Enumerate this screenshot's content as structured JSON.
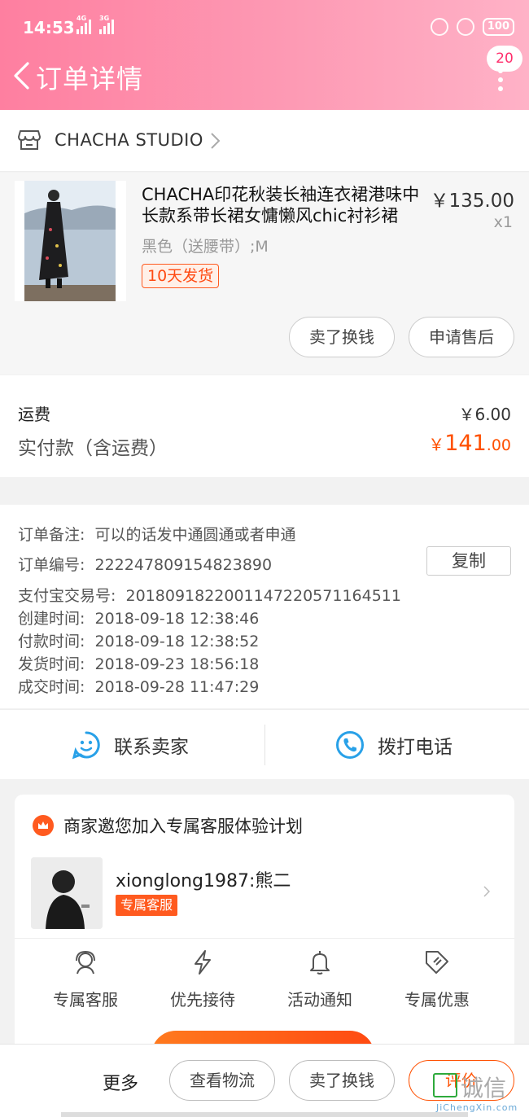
{
  "status_bar": {
    "time": "14:53",
    "sig1_tag": "4G",
    "sig2_tag": "3G",
    "battery": "100"
  },
  "nav": {
    "title": "订单详情",
    "message_count": "20"
  },
  "shop": {
    "name": "CHACHA STUDIO"
  },
  "product": {
    "title": "CHACHA印花秋装长袖连衣裙港味中长款系带长裙女慵懒风chic衬衫裙",
    "price": "￥135.00",
    "qty": "x1",
    "spec": "黑色（送腰带）;M",
    "ship_tag": "10天发货",
    "btn_sell": "卖了换钱",
    "btn_after_sale": "申请售后"
  },
  "payment": {
    "freight_label": "运费",
    "freight_value": "￥6.00",
    "paid_label": "实付款（含运费）",
    "paid_currency": "￥",
    "paid_int": "141",
    "paid_dec": ".00"
  },
  "info": {
    "remark_label": "订单备注:",
    "remark_value": "可以的话发中通圆通或者申通",
    "order_no_label": "订单编号:",
    "order_no_value": "222247809154823890",
    "copy_btn": "复制",
    "alipay_label": "支付宝交易号:",
    "alipay_value": "2018091822001147220571164511",
    "created_label": "创建时间:",
    "created_value": "2018-09-18 12:38:46",
    "paid_time_label": "付款时间:",
    "paid_time_value": "2018-09-18 12:38:52",
    "shipped_label": "发货时间:",
    "shipped_value": "2018-09-23 18:56:18",
    "done_label": "成交时间:",
    "done_value": "2018-09-28 11:47:29"
  },
  "contact": {
    "seller": "联系卖家",
    "phone": "拨打电话"
  },
  "service_card": {
    "title": "商家邀您加入专属客服体验计划",
    "agent_name": "xionglong1987:熊二",
    "agent_tag": "专属客服",
    "features": [
      "专属客服",
      "优先接待",
      "活动通知",
      "专属优惠"
    ]
  },
  "bottom_bar": {
    "more": "更多",
    "logistics": "查看物流",
    "sell": "卖了换钱",
    "review": "评价"
  },
  "watermark": {
    "text": "诚信",
    "sub": "JiChengXin.com"
  },
  "colors": {
    "header_pink": "#fe7fa0",
    "accent_orange": "#ff5000",
    "service_orange": "#ff5a1f",
    "contact_blue": "#29a1e8"
  }
}
